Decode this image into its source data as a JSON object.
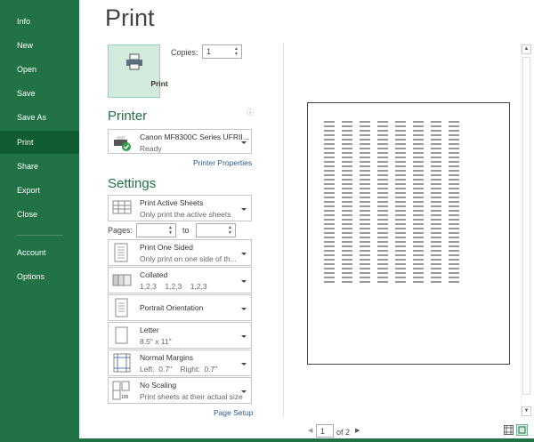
{
  "sidebar": {
    "items": [
      "Info",
      "New",
      "Open",
      "Save",
      "Save As",
      "Print",
      "Share",
      "Export",
      "Close",
      "Account",
      "Options"
    ],
    "selected": "Print"
  },
  "title": "Print",
  "print_button": "Print",
  "copies": {
    "label": "Copies:",
    "value": "1"
  },
  "printer": {
    "heading": "Printer",
    "name": "Canon MF8300C Series UFRII...",
    "status": "Ready",
    "properties_link": "Printer Properties"
  },
  "settings": {
    "heading": "Settings",
    "what": {
      "title": "Print Active Sheets",
      "sub": "Only print the active sheets"
    },
    "pages": {
      "label": "Pages:",
      "to": "to",
      "from_value": "",
      "to_value": ""
    },
    "sides": {
      "title": "Print One Sided",
      "sub": "Only print on one side of th..."
    },
    "collate": {
      "title": "Collated",
      "sub": "1,2,3    1,2,3    1,2,3"
    },
    "orientation": {
      "title": "Portrait Orientation"
    },
    "paper": {
      "title": "Letter",
      "sub": "8.5\" x 11\""
    },
    "margins": {
      "title": "Normal Margins",
      "sub": "Left:  0.7\"    Right:  0.7\""
    },
    "scaling": {
      "title": "No Scaling",
      "sub": "Print sheets at their actual size"
    },
    "page_setup_link": "Page Setup"
  },
  "preview": {
    "current_page": "1",
    "of_label": "of 2"
  },
  "colors": {
    "accent": "#217346"
  }
}
